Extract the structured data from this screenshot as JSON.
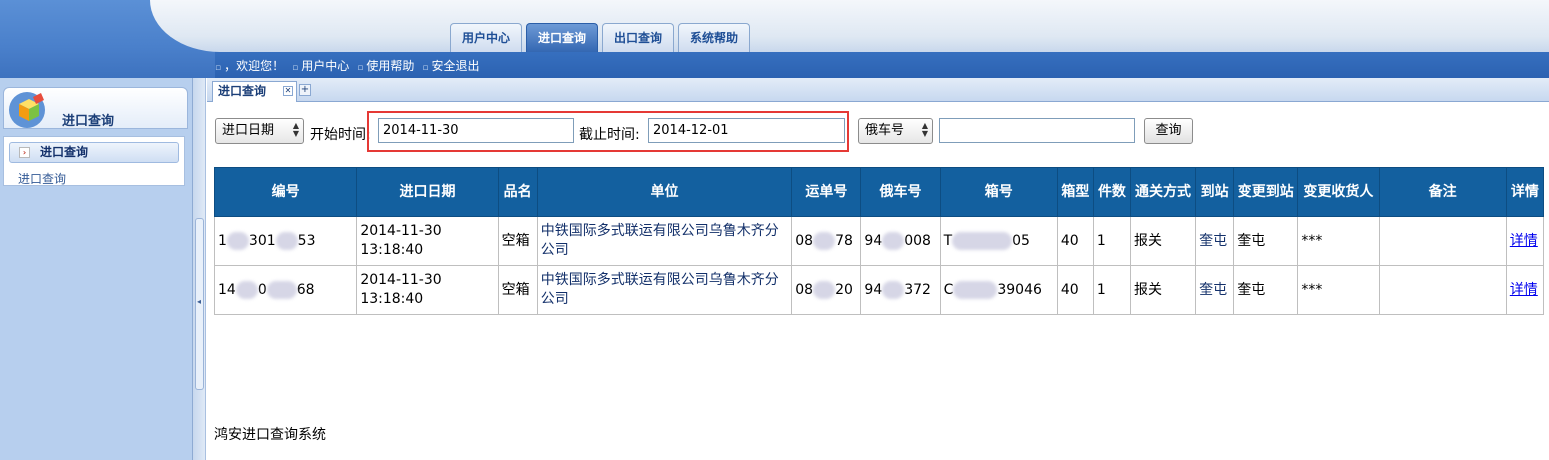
{
  "top_tabs": [
    {
      "label": "用户中心",
      "active": false
    },
    {
      "label": "进口查询",
      "active": true
    },
    {
      "label": "出口查询",
      "active": false
    },
    {
      "label": "系统帮助",
      "active": false
    }
  ],
  "subnav": {
    "welcome": "，欢迎您！",
    "user_center": "用户中心",
    "help": "使用帮助",
    "logout": "安全退出"
  },
  "sidebar": {
    "panel_title": "进口查询",
    "menu_selected": "进口查询",
    "menu_sub": "进口查询"
  },
  "content_tab": {
    "label": "进口查询"
  },
  "form": {
    "date_type": "进口日期",
    "start_label": "开始时间:",
    "start_value": "2014-11-30",
    "end_label": "截止时间:",
    "end_value": "2014-12-01",
    "field_type": "俄车号",
    "search_value": "",
    "search_button": "查询"
  },
  "table": {
    "headers": [
      "编号",
      "进口日期",
      "品名",
      "单位",
      "运单号",
      "俄车号",
      "箱号",
      "箱型",
      "件数",
      "通关方式",
      "到站",
      "变更到站",
      "变更收货人",
      "备注",
      "详情"
    ],
    "rows": [
      {
        "id_a": "1",
        "id_b": "301",
        "id_c": "53",
        "date": "2014-11-30 13:18:40",
        "product": "空箱",
        "unit": "中铁国际多式联运有限公司乌鲁木齐分公司",
        "waybill_a": "08",
        "waybill_b": "78",
        "wagon_a": "94",
        "wagon_b": "008",
        "box_a": "T",
        "box_b": "05",
        "box_type": "40",
        "count": "1",
        "customs": "报关",
        "station": "奎屯",
        "changed_station": "奎屯",
        "changed_consignee": "***",
        "remark": "",
        "detail": "详情"
      },
      {
        "id_a": "14",
        "id_b": "0",
        "id_c": "68",
        "date": "2014-11-30 13:18:40",
        "product": "空箱",
        "unit": "中铁国际多式联运有限公司乌鲁木齐分公司",
        "waybill_a": "08",
        "waybill_b": "20",
        "wagon_a": "94",
        "wagon_b": "372",
        "box_a": "C",
        "box_b": "39046",
        "box_type": "40",
        "count": "1",
        "customs": "报关",
        "station": "奎屯",
        "changed_station": "奎屯",
        "changed_consignee": "***",
        "remark": "",
        "detail": "详情"
      }
    ]
  },
  "footer": {
    "text": "鸿安进口查询系统"
  },
  "colors": {
    "header_blue": "#2f67b8",
    "table_header": "#13609f",
    "highlight_border": "#e53935"
  }
}
